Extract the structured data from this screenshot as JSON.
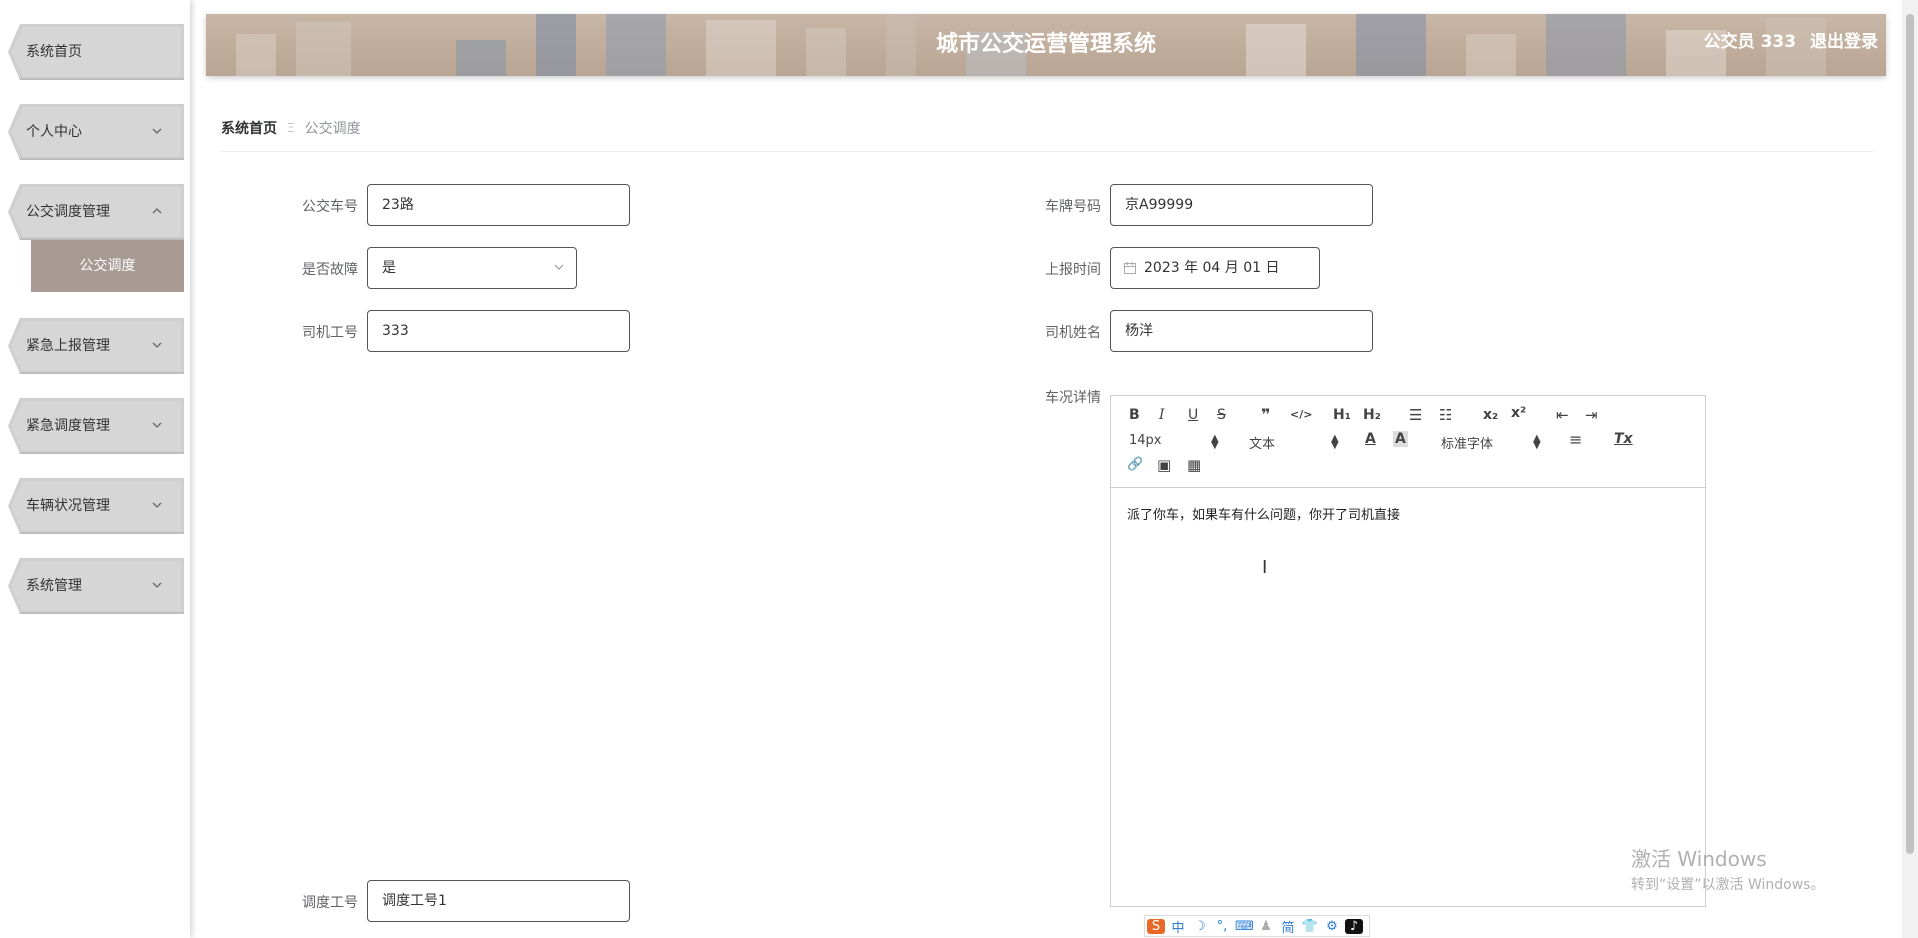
{
  "sidebar": {
    "items": [
      {
        "label": "系统首页"
      },
      {
        "label": "个人中心"
      },
      {
        "label": "公交调度管理"
      },
      {
        "label": "紧急上报管理"
      },
      {
        "label": "紧急调度管理"
      },
      {
        "label": "车辆状况管理"
      },
      {
        "label": "系统管理"
      }
    ],
    "submenu": {
      "label": "公交调度"
    }
  },
  "header": {
    "title": "城市公交运营管理系统",
    "user": "公交员 333",
    "logout": "退出登录"
  },
  "breadcrumb": {
    "home": "系统首页",
    "separator": "Ξ",
    "current": "公交调度"
  },
  "form": {
    "bus_no": {
      "label": "公交车号",
      "value": "23路"
    },
    "plate_no": {
      "label": "车牌号码",
      "value": "京A99999"
    },
    "fault": {
      "label": "是否故障",
      "value": "是"
    },
    "report_time": {
      "label": "上报时间",
      "value": "2023 年 04 月 01 日"
    },
    "driver_id": {
      "label": "司机工号",
      "value": "333"
    },
    "driver_name": {
      "label": "司机姓名",
      "value": "杨洋"
    },
    "condition": {
      "label": "车况详情"
    },
    "dispatch_id": {
      "label": "调度工号",
      "value": "调度工号1"
    }
  },
  "editor": {
    "toolbar": {
      "bold": "B",
      "italic": "I",
      "underline": "U",
      "strike": "S",
      "quote": "❞",
      "code": "</>",
      "h1": "H₁",
      "h2": "H₂",
      "ordered_list": "☰",
      "bullet_list": "☷",
      "subscript": "x₂",
      "superscript": "x²",
      "outdent": "⇤",
      "indent": "⇥",
      "size": "14px",
      "header": "文本",
      "font": "标准字体",
      "text_color": "A",
      "background": "A",
      "align": "≡",
      "clean": "Tx",
      "link": "🔗",
      "image": "▣",
      "video": "▦"
    },
    "content": "派了你车，如果车有什么问题，你开了司机直接"
  },
  "watermark": {
    "line1": "激活 Windows",
    "line2": "转到“设置”以激活 Windows。"
  },
  "ime": [
    "S",
    "中",
    "☽",
    "°,",
    "⌨",
    "♟",
    "简",
    "👕",
    "⚙",
    "♪"
  ],
  "colors": {
    "header_bg": "#c0ad9c",
    "submenu_bg": "#a79b94",
    "menu_bg": "#d0d0d0"
  }
}
